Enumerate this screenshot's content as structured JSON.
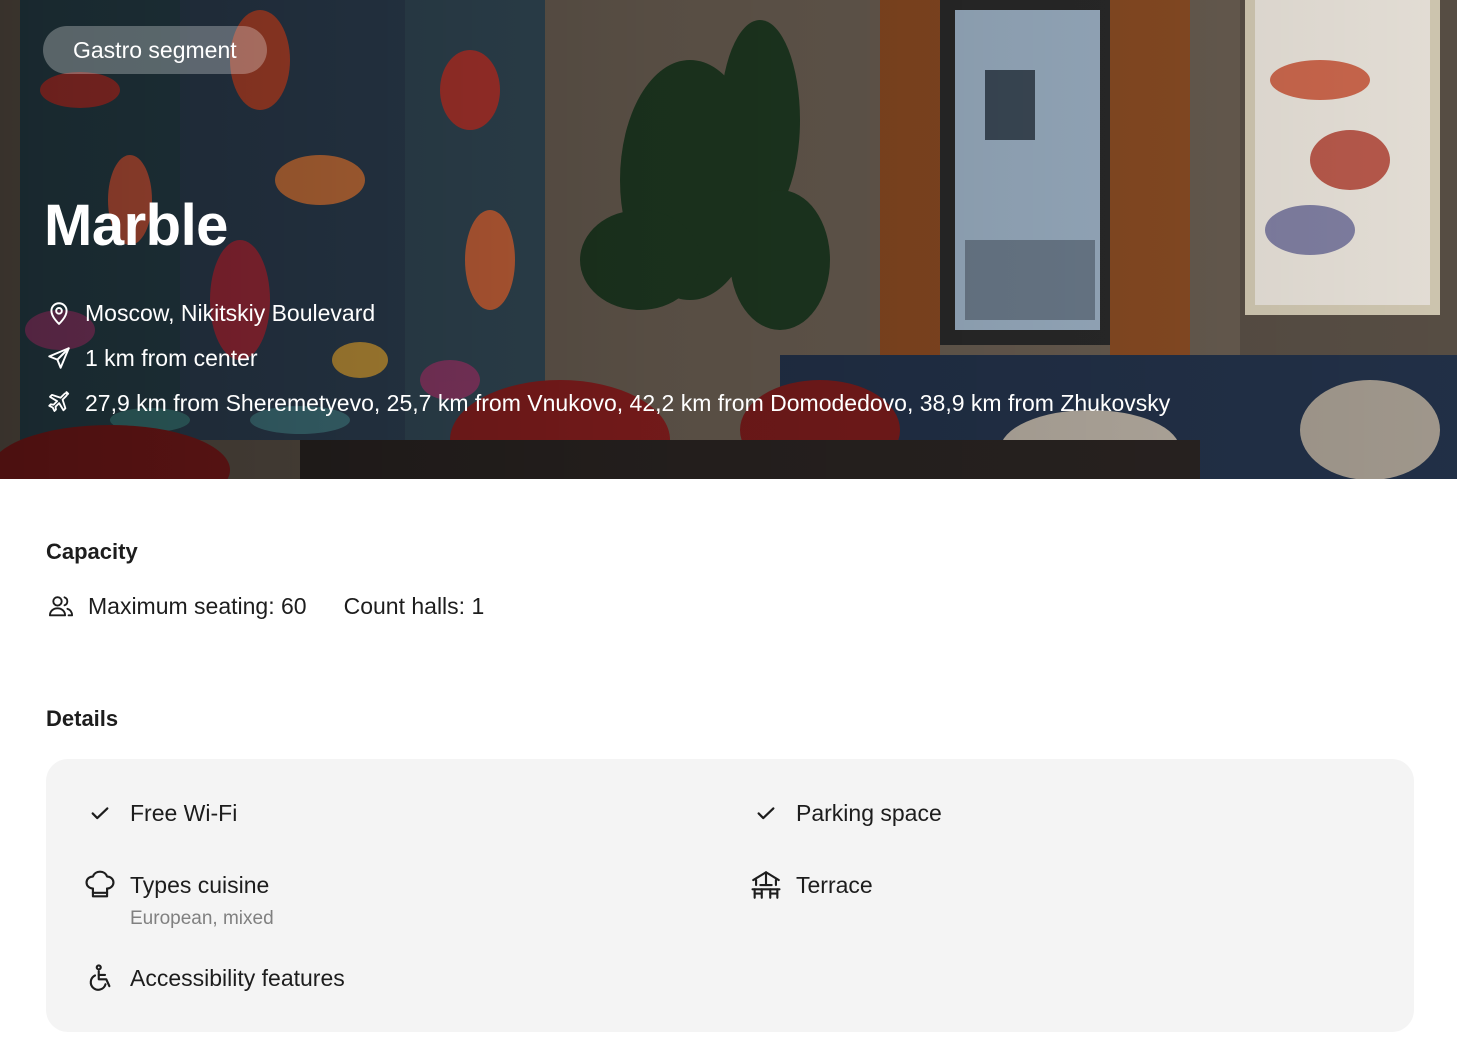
{
  "hero": {
    "badge": "Gastro segment",
    "title": "Marble",
    "address": "Moscow, Nikitskiy Boulevard",
    "distance_center": "1 km from center",
    "airports": "27,9 km from Sheremetyevo, 25,7 km from Vnukovo, 42,2 km from Domodedovo, 38,9 km from Zhukovsky",
    "icons": {
      "address": "location-pin-icon",
      "center": "navigation-arrow-icon",
      "airports": "airplane-icon"
    }
  },
  "capacity": {
    "title": "Capacity",
    "seating": "Maximum seating: 60",
    "halls": "Count halls: 1",
    "icon": "people-icon"
  },
  "details": {
    "title": "Details",
    "features": {
      "wifi": {
        "label": "Free Wi-Fi",
        "icon": "check-icon"
      },
      "parking": {
        "label": "Parking space",
        "icon": "check-icon"
      },
      "cuisine": {
        "label": "Types cuisine",
        "sub": "European, mixed",
        "icon": "chef-hat-icon"
      },
      "terrace": {
        "label": "Terrace",
        "icon": "terrace-icon"
      },
      "accessibility": {
        "label": "Accessibility features",
        "icon": "wheelchair-icon"
      }
    }
  },
  "colors": {
    "card_background": "#f4f4f4",
    "text": "#1d1d1d",
    "muted_text": "#808080",
    "hero_text": "#ffffff"
  }
}
